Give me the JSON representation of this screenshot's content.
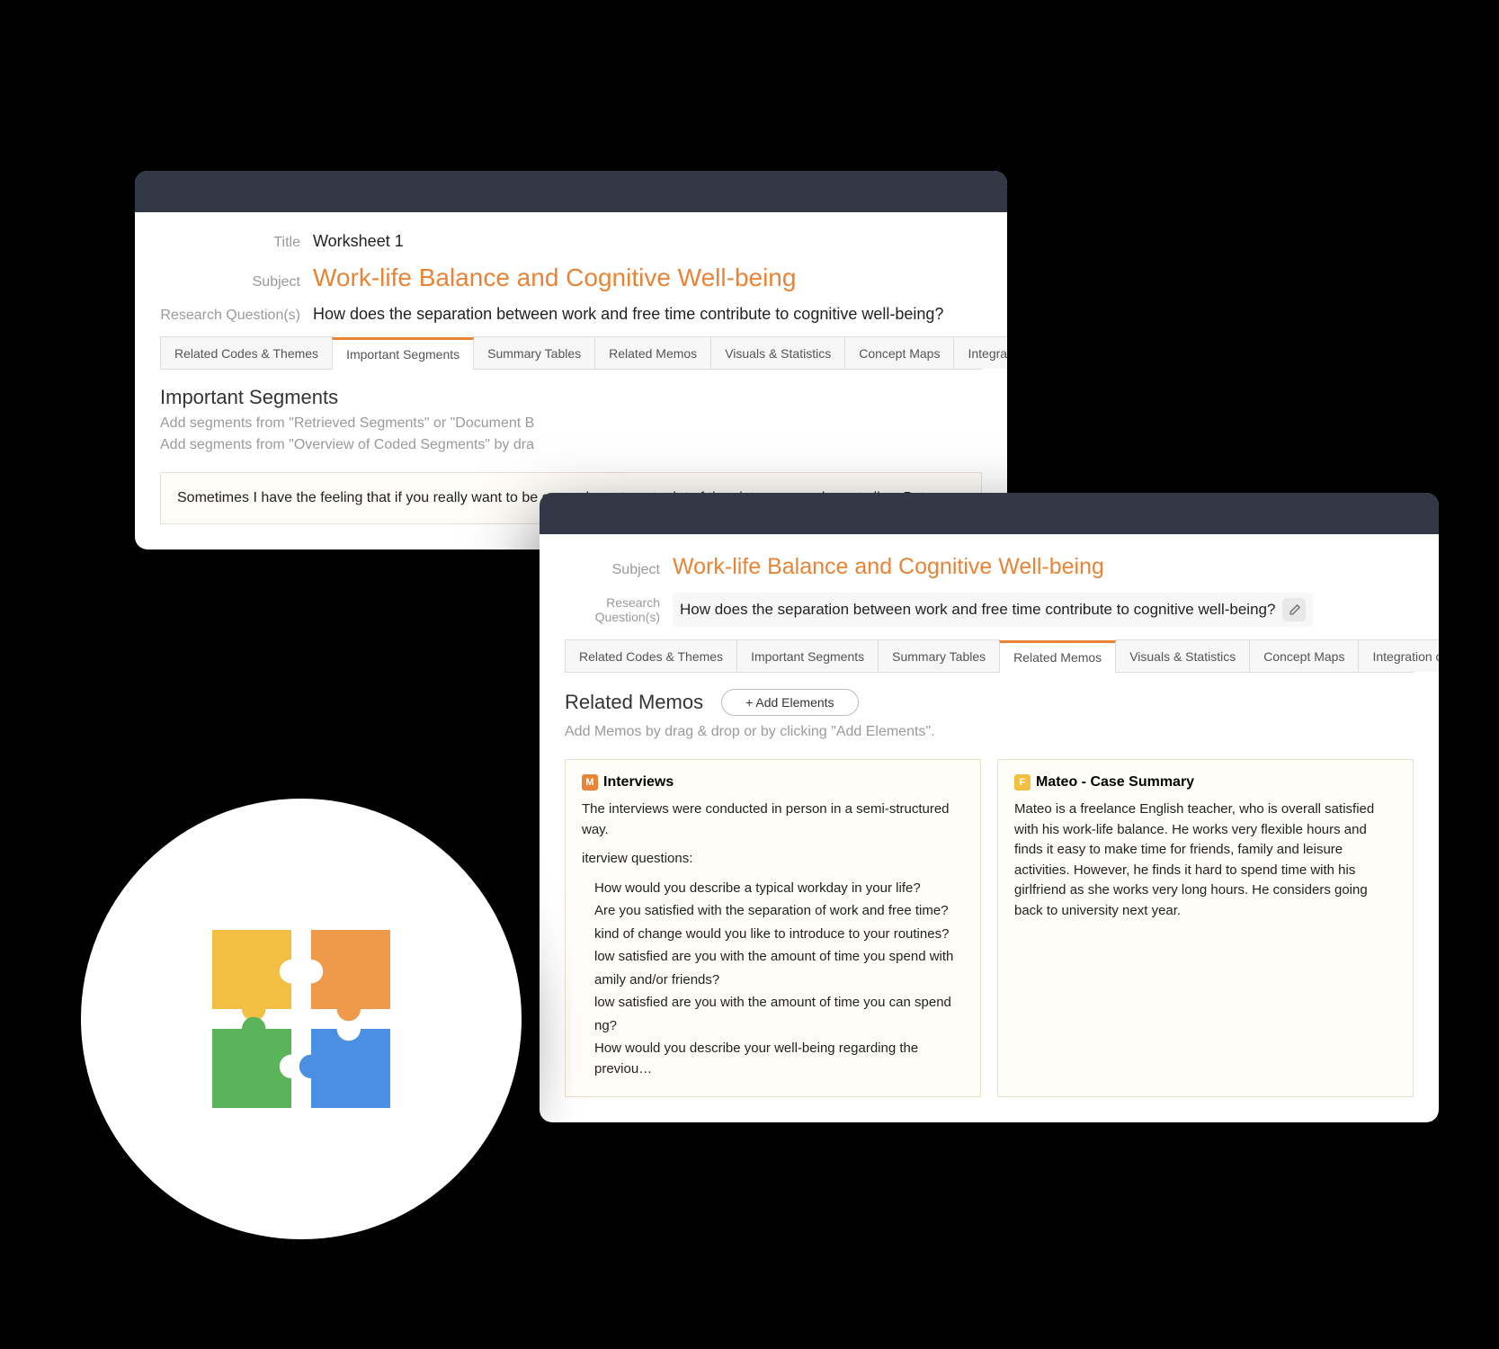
{
  "back": {
    "title_label": "Title",
    "title_value": "Worksheet 1",
    "subject_label": "Subject",
    "subject_value": "Work-life Balance and Cognitive Well-being",
    "rq_label": "Research Question(s)",
    "rq_value": "How does the separation between work and free time contribute to cognitive well-being?",
    "tabs": [
      "Related Codes & Themes",
      "Important Segments",
      "Summary Tables",
      "Related Memos",
      "Visuals & Statistics",
      "Concept Maps",
      "Integration of Insights"
    ],
    "active_tab_index": 1,
    "section_title": "Important Segments",
    "section_sub_line1": "Add segments from \"Retrieved Segments\" or \"Document B",
    "section_sub_line2": "Add segments from \"Overview of Coded Segments\" by dra",
    "segment_text": "Sometimes I have the feeling that if you really want to be or you have to put a lot of time into your work or studies. But o"
  },
  "front": {
    "subject_label": "Subject",
    "subject_value": "Work-life Balance and Cognitive Well-being",
    "rq_label": "Research Question(s)",
    "rq_value": "How does the separation between work and free time contribute to cognitive well-being?",
    "tabs": [
      "Related Codes & Themes",
      "Important Segments",
      "Summary Tables",
      "Related Memos",
      "Visuals & Statistics",
      "Concept Maps",
      "Integration of Insights"
    ],
    "active_tab_index": 3,
    "section_title": "Related Memos",
    "add_button": "+ Add Elements",
    "section_sub": "Add Memos by drag & drop or by clicking \"Add Elements\".",
    "memos": [
      {
        "badge": "M",
        "title": "Interviews",
        "intro": "The interviews were conducted in person in a semi-structured way.",
        "q_heading": "iterview questions:",
        "questions": [
          "How would you describe a typical workday in your life?",
          "Are you satisfied with the separation of work and free time?",
          "kind of change would you like to introduce to your routines?",
          "low satisfied are you with the amount of time you spend with",
          "amily and/or friends?",
          "low satisfied are you with the amount of time you can spend",
          "ng?",
          "How would you describe your well-being regarding the previou…"
        ]
      },
      {
        "badge": "F",
        "title": "Mateo - Case Summary",
        "text": "Mateo is a freelance English teacher, who is overall satisfied with his work-life balance. He works very flexible hours and finds it easy to make time for friends, family and leisure activities. However, he finds it hard to spend time with his girlfriend as she works very long hours. He considers going back to university next year."
      }
    ]
  }
}
